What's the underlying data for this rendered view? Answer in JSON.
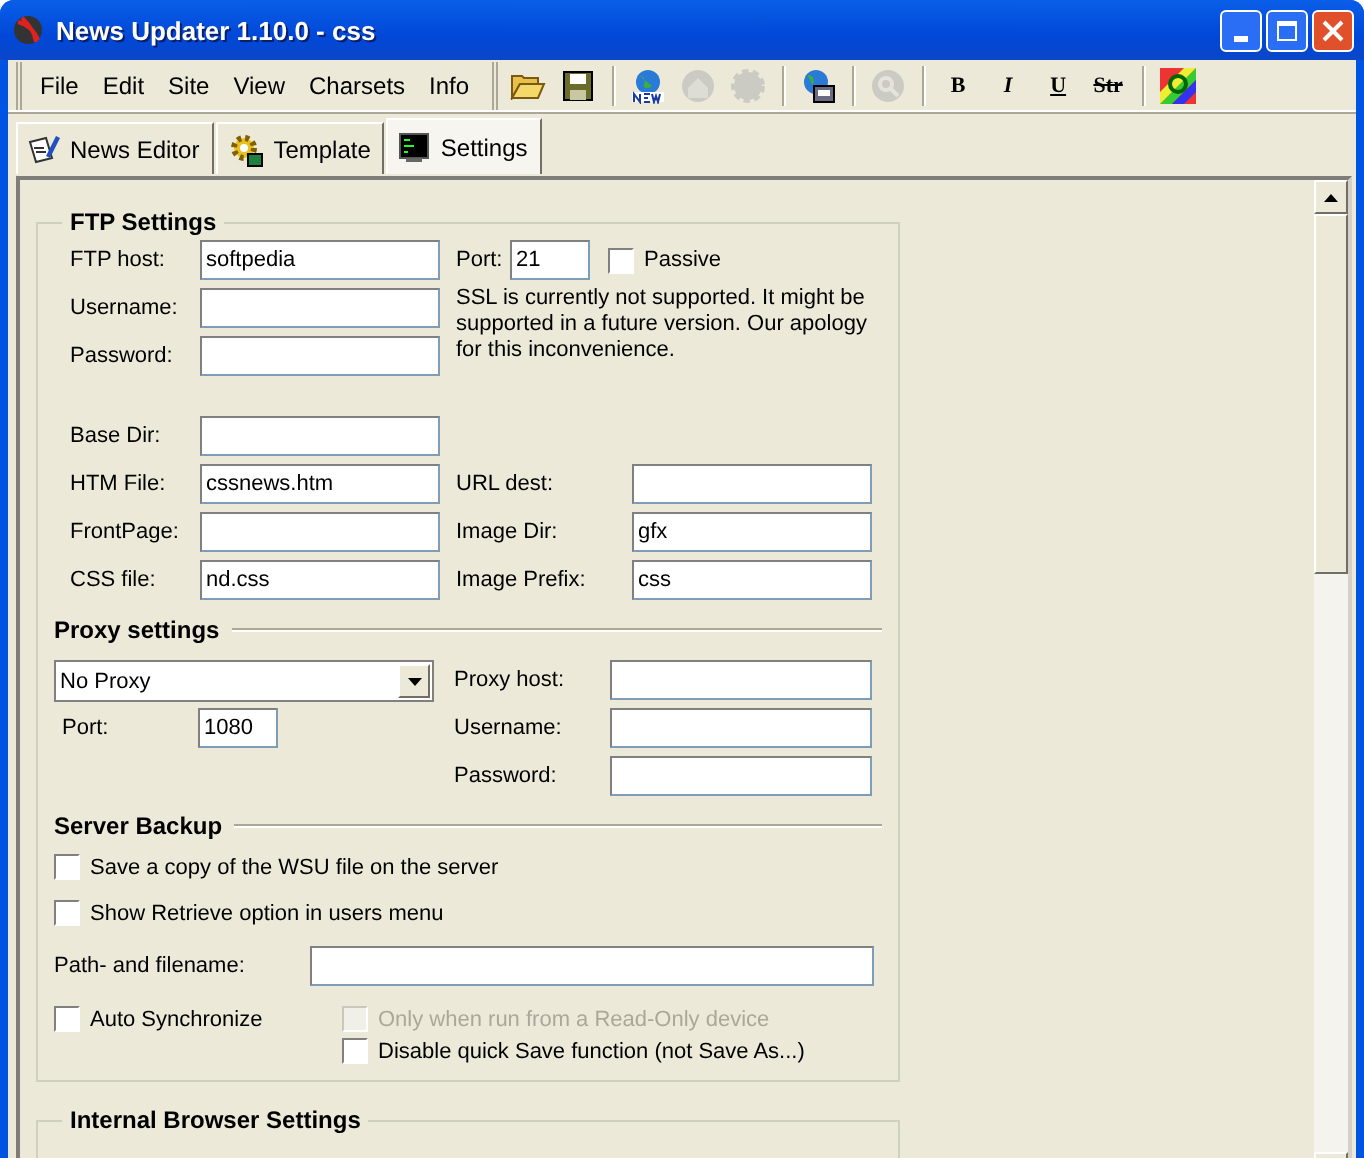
{
  "window": {
    "title": "News Updater 1.10.0 - css"
  },
  "menu": [
    "File",
    "Edit",
    "Site",
    "View",
    "Charsets",
    "Info"
  ],
  "toolbar": [
    {
      "kind": "open",
      "disabled": false
    },
    {
      "kind": "save",
      "disabled": false
    },
    {
      "kind": "sep"
    },
    {
      "kind": "new-globe",
      "disabled": false
    },
    {
      "kind": "house",
      "disabled": true
    },
    {
      "kind": "gear",
      "disabled": true
    },
    {
      "kind": "sep"
    },
    {
      "kind": "globe-pc",
      "disabled": false
    },
    {
      "kind": "sep"
    },
    {
      "kind": "magnifier",
      "disabled": true
    },
    {
      "kind": "sep"
    },
    {
      "kind": "bold",
      "label": "B",
      "disabled": false
    },
    {
      "kind": "italic",
      "label": "I",
      "disabled": false
    },
    {
      "kind": "underline",
      "label": "U",
      "disabled": false
    },
    {
      "kind": "strike",
      "label": "Str",
      "disabled": false
    },
    {
      "kind": "sep"
    },
    {
      "kind": "color",
      "disabled": false
    }
  ],
  "tabs": [
    {
      "label": "News Editor",
      "kind": "pen",
      "selected": false
    },
    {
      "label": "Template",
      "kind": "gear",
      "selected": false
    },
    {
      "label": "Settings",
      "kind": "screen",
      "selected": true
    }
  ],
  "ftp_settings": {
    "title": "FTP Settings",
    "host": {
      "label": "FTP host:",
      "value": "softpedia"
    },
    "port": {
      "label": "Port:",
      "value": "21"
    },
    "passive": {
      "label": "Passive",
      "checked": false
    },
    "username": {
      "label": "Username:"
    },
    "password": {
      "label": "Password:"
    },
    "ssl_note": "SSL is currently not supported. It might be supported in a future version. Our apology for this inconvenience.",
    "base_dir": {
      "label": "Base Dir:"
    },
    "htm_file": {
      "label": "HTM File:",
      "value": "cssnews.htm"
    },
    "url_dest": {
      "label": "URL dest:"
    },
    "frontpage": {
      "label": "FrontPage:"
    },
    "image_dir": {
      "label": "Image Dir:",
      "value": "gfx"
    },
    "css_file": {
      "label": "CSS file:",
      "value": "nd.css"
    },
    "image_prefix": {
      "label": "Image Prefix:",
      "value": "css"
    },
    "proxy": {
      "title": "Proxy settings",
      "mode": "No Proxy",
      "port": {
        "label": "Port:",
        "value": "1080"
      },
      "host": {
        "label": "Proxy host:"
      },
      "username": {
        "label": "Username:"
      },
      "password": {
        "label": "Password:"
      }
    },
    "server_backup": {
      "title": "Server Backup",
      "save_copy": {
        "label": "Save a copy of the WSU file on the server",
        "checked": false,
        "disabled": false
      },
      "show_retrieve": {
        "label": "Show Retrieve option in users menu",
        "checked": false,
        "disabled": false
      },
      "path": {
        "label": "Path- and filename:"
      },
      "auto_sync": {
        "label": "Auto Synchronize",
        "checked": false,
        "disabled": false
      },
      "read_only": {
        "label": "Only when run from a Read-Only device",
        "checked": false,
        "disabled": true
      },
      "disable_quick_save": {
        "label": "Disable quick Save function (not Save As...)",
        "checked": false,
        "disabled": false
      }
    }
  },
  "internal_browser": {
    "title": "Internal Browser Settings"
  }
}
